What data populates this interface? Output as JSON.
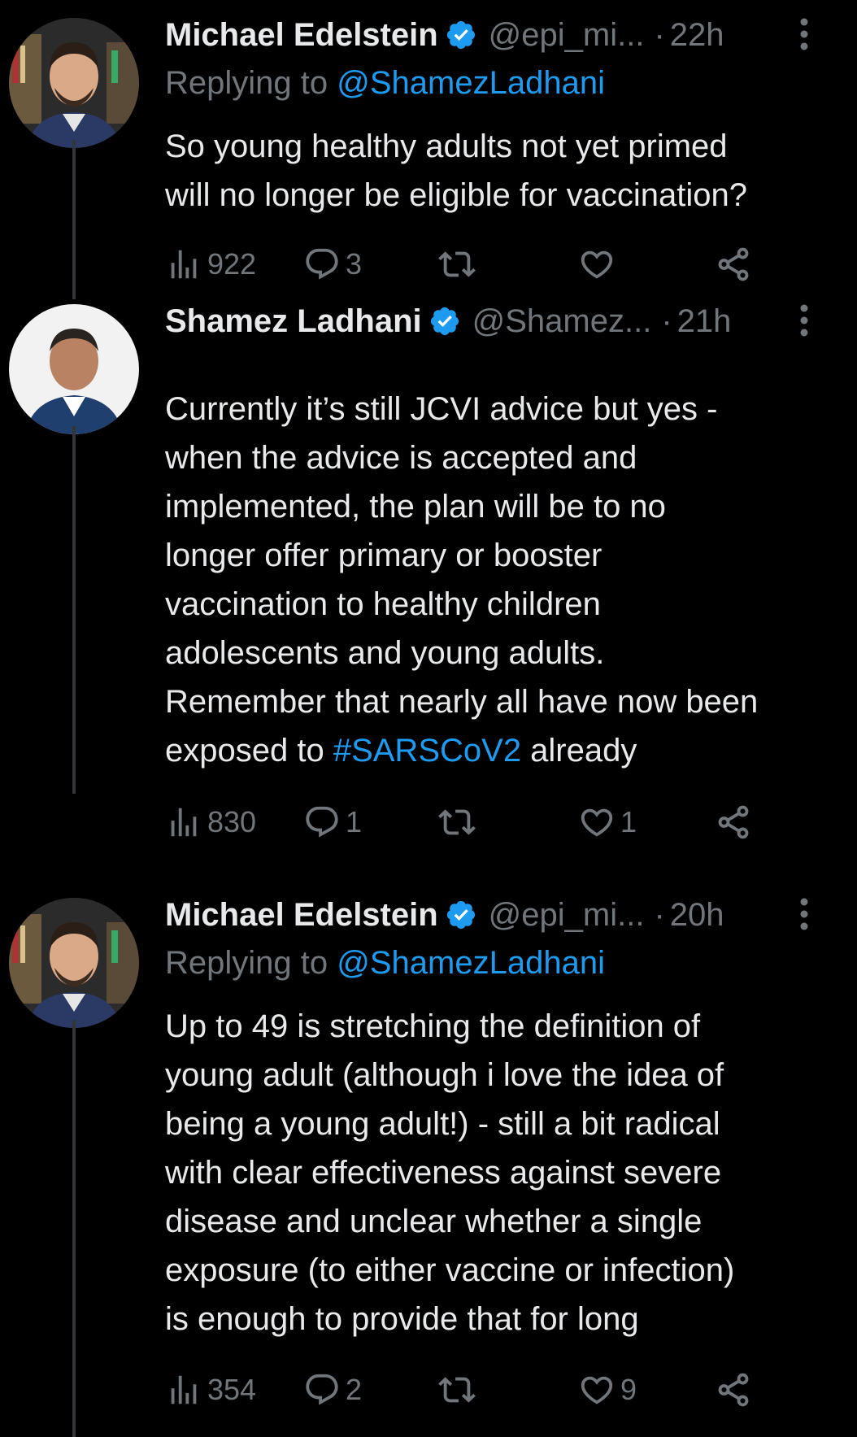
{
  "colors": {
    "background": "#000000",
    "text": "#e7e9ea",
    "muted": "#71767b",
    "link": "#1d9bf0",
    "verified": "#1d9bf0",
    "thread_line": "#333639"
  },
  "tweets": [
    {
      "name": "Michael Edelstein",
      "handle": "@epi_mi...",
      "separator": "·",
      "time": "22h",
      "replying_prefix": "Replying to",
      "replying_handle": "@ShamezLadhani",
      "lines": [
        {
          "pre": "So young healthy adults  not yet primed",
          "link": "",
          "post": ""
        },
        {
          "pre": "will no longer be eligible for vaccination?",
          "link": "",
          "post": ""
        }
      ],
      "views": "922",
      "replies": "3",
      "retweets": "",
      "likes": ""
    },
    {
      "name": "Shamez Ladhani",
      "handle": "@Shamez...",
      "separator": "·",
      "time": "21h",
      "replying_prefix": "",
      "replying_handle": "",
      "lines": [
        {
          "pre": "Currently it’s still JCVI advice but yes -",
          "link": "",
          "post": ""
        },
        {
          "pre": "when the advice is accepted and",
          "link": "",
          "post": ""
        },
        {
          "pre": "implemented, the plan will be to no",
          "link": "",
          "post": ""
        },
        {
          "pre": "longer offer primary or booster",
          "link": "",
          "post": ""
        },
        {
          "pre": "vaccination to healthy children",
          "link": "",
          "post": ""
        },
        {
          "pre": "adolescents and young adults.",
          "link": "",
          "post": ""
        },
        {
          "pre": "Remember that nearly all have now been",
          "link": "",
          "post": ""
        },
        {
          "pre": "exposed to ",
          "link": "#SARSCoV2",
          "post": " already"
        }
      ],
      "views": "830",
      "replies": "1",
      "retweets": "",
      "likes": "1"
    },
    {
      "name": "Michael Edelstein",
      "handle": "@epi_mi...",
      "separator": "·",
      "time": "20h",
      "replying_prefix": "Replying to",
      "replying_handle": "@ShamezLadhani",
      "lines": [
        {
          "pre": "Up to 49 is stretching the definition of",
          "link": "",
          "post": ""
        },
        {
          "pre": "young adult (although i love the idea of",
          "link": "",
          "post": ""
        },
        {
          "pre": "being a young adult!) - still a bit radical",
          "link": "",
          "post": ""
        },
        {
          "pre": "with clear effectiveness against severe",
          "link": "",
          "post": ""
        },
        {
          "pre": "disease and unclear whether a single",
          "link": "",
          "post": ""
        },
        {
          "pre": "exposure (to either vaccine or infection)",
          "link": "",
          "post": ""
        },
        {
          "pre": "is enough to provide that for long",
          "link": "",
          "post": ""
        }
      ],
      "views": "354",
      "replies": "2",
      "retweets": "",
      "likes": "9"
    }
  ]
}
